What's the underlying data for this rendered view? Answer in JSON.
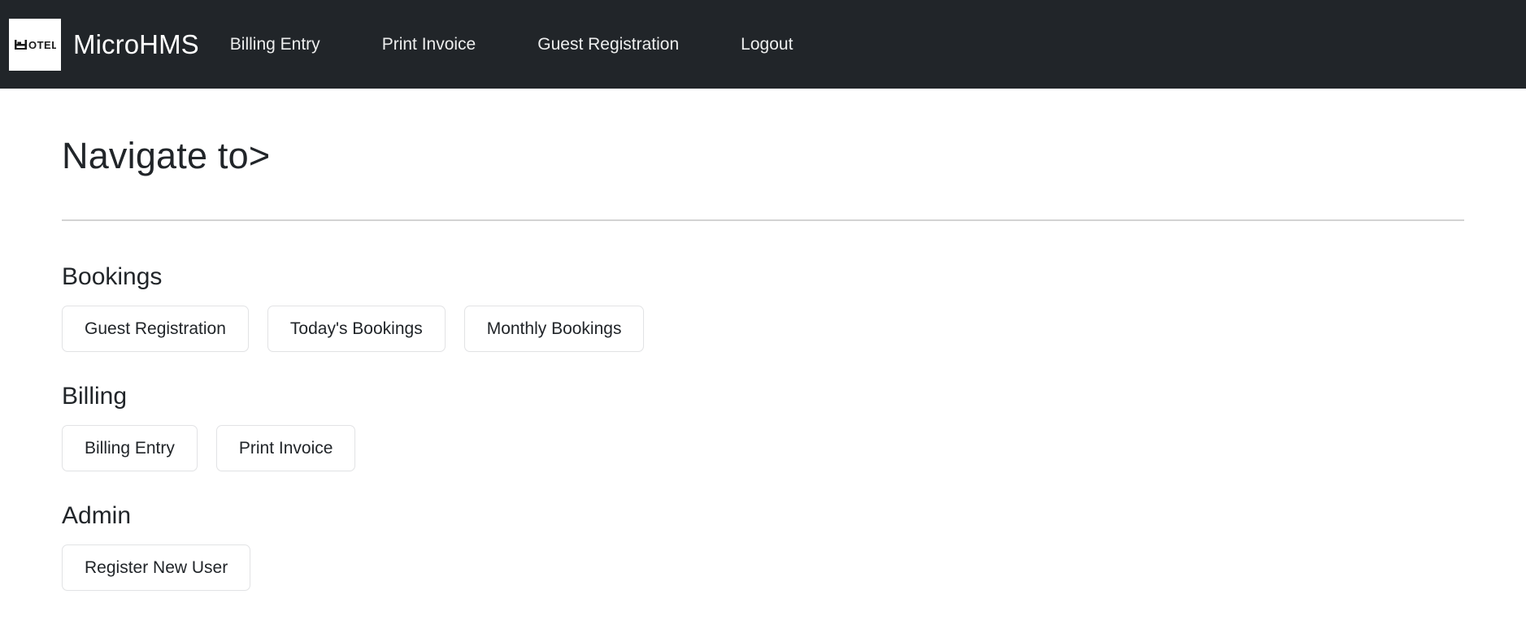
{
  "navbar": {
    "brand_name": "MicroHMS",
    "logo_icon": "hotel-bed-logo-icon",
    "logo_text": "HOTEL",
    "links": [
      {
        "label": "Billing Entry"
      },
      {
        "label": "Print Invoice"
      },
      {
        "label": "Guest Registration"
      },
      {
        "label": "Logout"
      }
    ]
  },
  "main": {
    "page_title": "Navigate to>",
    "sections": [
      {
        "id": "bookings",
        "title": "Bookings",
        "buttons": [
          {
            "label": "Guest Registration"
          },
          {
            "label": "Today's Bookings"
          },
          {
            "label": "Monthly Bookings"
          }
        ]
      },
      {
        "id": "billing",
        "title": "Billing",
        "buttons": [
          {
            "label": "Billing Entry"
          },
          {
            "label": "Print Invoice"
          }
        ]
      },
      {
        "id": "admin",
        "title": "Admin",
        "buttons": [
          {
            "label": "Register New User"
          }
        ]
      }
    ]
  },
  "colors": {
    "navbar_background": "#212529",
    "navbar_text": "#ffffff",
    "page_background": "#ffffff",
    "body_text": "#212529",
    "button_border": "#e2e3e5",
    "divider": "#d3d3d3"
  }
}
